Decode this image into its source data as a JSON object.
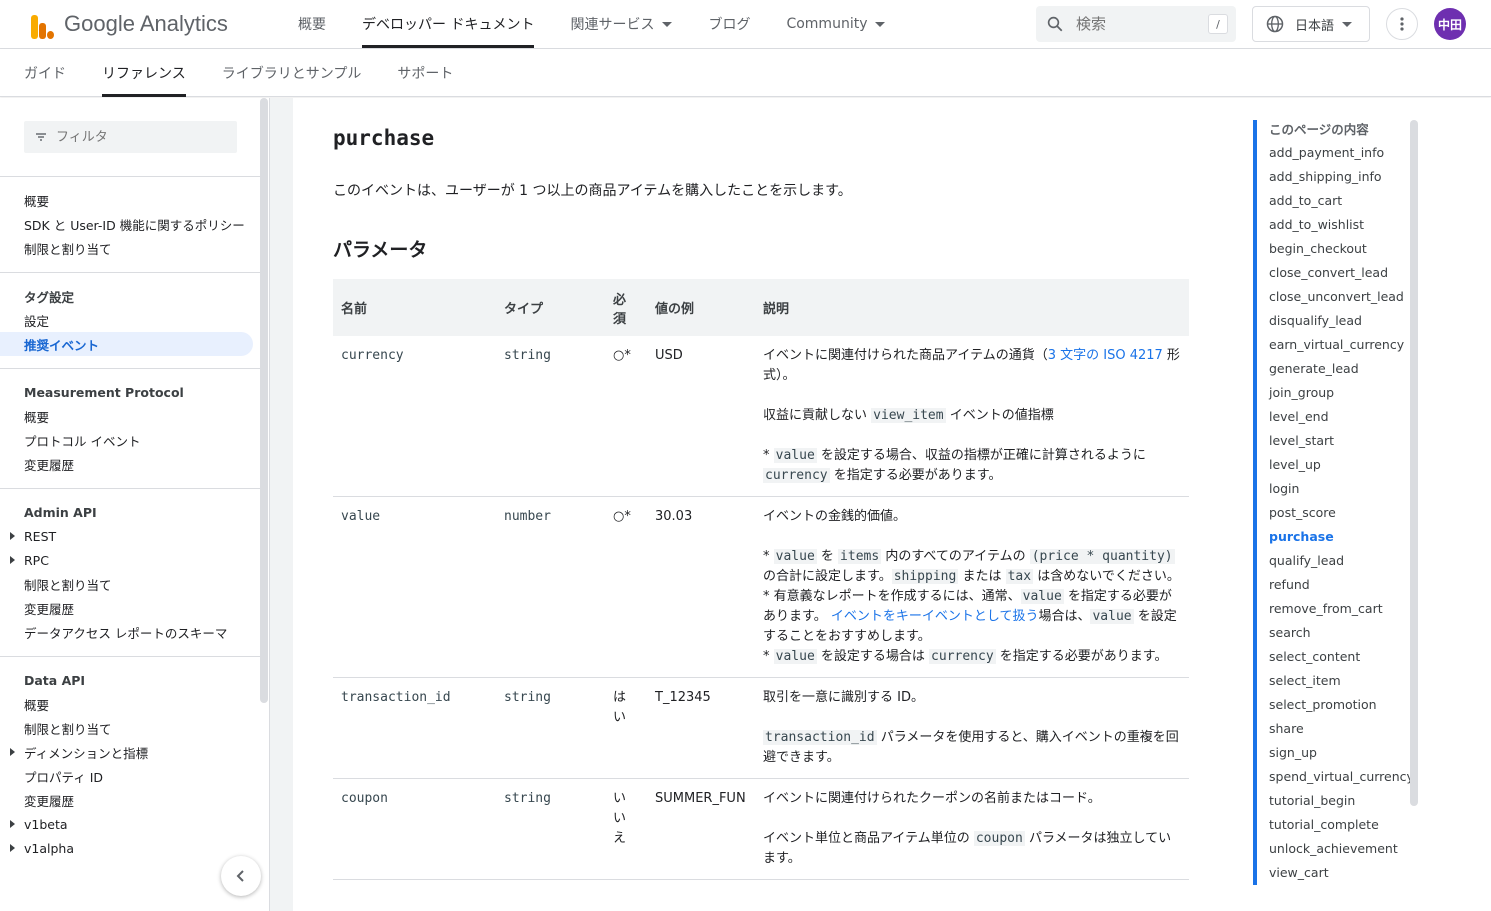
{
  "header": {
    "logo_text": "Google Analytics",
    "nav": [
      {
        "label": "概要",
        "active": false,
        "dropdown": false
      },
      {
        "label": "デベロッパー ドキュメント",
        "active": true,
        "dropdown": false
      },
      {
        "label": "関連サービス",
        "active": false,
        "dropdown": true
      },
      {
        "label": "ブログ",
        "active": false,
        "dropdown": false
      },
      {
        "label": "Community",
        "active": false,
        "dropdown": true
      }
    ],
    "search_placeholder": "検索",
    "search_shortcut": "/",
    "language": "日本語",
    "avatar_text": "中田"
  },
  "subtabs": [
    {
      "label": "ガイド",
      "active": false
    },
    {
      "label": "リファレンス",
      "active": true
    },
    {
      "label": "ライブラリとサンプル",
      "active": false
    },
    {
      "label": "サポート",
      "active": false
    }
  ],
  "sidebar": {
    "filter_placeholder": "フィルタ",
    "groups": [
      {
        "items": [
          {
            "label": "概要"
          },
          {
            "label": "SDK と User-ID 機能に関するポリシー"
          },
          {
            "label": "制限と割り当て"
          }
        ]
      },
      {
        "items": [
          {
            "label": "タグ設定",
            "head": true
          },
          {
            "label": "設定"
          },
          {
            "label": "推奨イベント",
            "active": true
          }
        ]
      },
      {
        "items": [
          {
            "label": "Measurement Protocol",
            "head": true
          },
          {
            "label": "概要"
          },
          {
            "label": "プロトコル イベント"
          },
          {
            "label": "変更履歴"
          }
        ]
      },
      {
        "items": [
          {
            "label": "Admin API",
            "head": true
          },
          {
            "label": "REST",
            "expandable": true
          },
          {
            "label": "RPC",
            "expandable": true
          },
          {
            "label": "制限と割り当て"
          },
          {
            "label": "変更履歴"
          },
          {
            "label": "データアクセス レポートのスキーマ"
          }
        ]
      },
      {
        "items": [
          {
            "label": "Data API",
            "head": true
          },
          {
            "label": "概要"
          },
          {
            "label": "制限と割り当て"
          },
          {
            "label": "ディメンションと指標",
            "expandable": true
          },
          {
            "label": "プロパティ ID"
          },
          {
            "label": "変更履歴"
          },
          {
            "label": "v1beta",
            "expandable": true
          },
          {
            "label": "v1alpha",
            "expandable": true
          }
        ]
      }
    ]
  },
  "content": {
    "title": "purchase",
    "intro": "このイベントは、ユーザーが 1 つ以上の商品アイテムを購入したことを示します。",
    "params_heading": "パラメータ",
    "table": {
      "headers": [
        "名前",
        "タイプ",
        "必須",
        "値の例",
        "説明"
      ],
      "rows": [
        {
          "name": "currency",
          "type": "string",
          "required": "○*",
          "example": "USD",
          "desc1_pre": "イベントに関連付けられた商品アイテムの通貨（",
          "desc1_link": "3 文字の ISO 4217",
          "desc1_post": " 形式）。",
          "desc2_pre": "収益に貢献しない ",
          "desc2_code": "view_item",
          "desc2_post": " イベントの値指標",
          "desc3_a": "* ",
          "desc3_code1": "value",
          "desc3_b": " を設定する場合、収益の指標が正確に計算されるように ",
          "desc3_code2": "currency",
          "desc3_c": " を指定する必要があります。"
        },
        {
          "name": "value",
          "type": "number",
          "required": "○*",
          "example": "30.03",
          "desc1": "イベントの金銭的価値。",
          "b1_a": "* ",
          "b1_c1": "value",
          "b1_b": " を ",
          "b1_c2": "items",
          "b1_c": " 内のすべてのアイテムの ",
          "b1_c3": "(price * quantity)",
          "b1_d": " の合計に設定します。",
          "b1_c4": "shipping",
          "b1_e": " または ",
          "b1_c5": "tax",
          "b1_f": " は含めないでください。",
          "b2_a": "* 有意義なレポートを作成するには、通常、",
          "b2_c1": "value",
          "b2_b": " を指定する必要があります。 ",
          "b2_link": "イベントをキーイベントとして扱う",
          "b2_c": "場合は、",
          "b2_c2": "value",
          "b2_d": " を設定することをおすすめします。",
          "b3_a": "* ",
          "b3_c1": "value",
          "b3_b": " を設定する場合は ",
          "b3_c2": "currency",
          "b3_c": " を指定する必要があります。"
        },
        {
          "name": "transaction_id",
          "type": "string",
          "required": "はい",
          "example": "T_12345",
          "desc1": "取引を一意に識別する ID。",
          "desc2_code": "transaction_id",
          "desc2_post": " パラメータを使用すると、購入イベントの重複を回避できます。"
        },
        {
          "name": "coupon",
          "type": "string",
          "required": "いいえ",
          "example": "SUMMER_FUN",
          "desc1": "イベントに関連付けられたクーポンの名前またはコード。",
          "desc2_pre": "イベント単位と商品アイテム単位の ",
          "desc2_code": "coupon",
          "desc2_post": " パラメータは独立しています。"
        }
      ]
    }
  },
  "toc": {
    "heading": "このページの内容",
    "items": [
      "add_payment_info",
      "add_shipping_info",
      "add_to_cart",
      "add_to_wishlist",
      "begin_checkout",
      "close_convert_lead",
      "close_unconvert_lead",
      "disqualify_lead",
      "earn_virtual_currency",
      "generate_lead",
      "join_group",
      "level_end",
      "level_start",
      "level_up",
      "login",
      "post_score",
      "purchase",
      "qualify_lead",
      "refund",
      "remove_from_cart",
      "search",
      "select_content",
      "select_item",
      "select_promotion",
      "share",
      "sign_up",
      "spend_virtual_currency",
      "tutorial_begin",
      "tutorial_complete",
      "unlock_achievement",
      "view_cart"
    ],
    "active": "purchase"
  },
  "colors": {
    "accent": "#1a73e8",
    "active_bg": "#e8f0fe",
    "avatar": "#6e2fb0"
  }
}
